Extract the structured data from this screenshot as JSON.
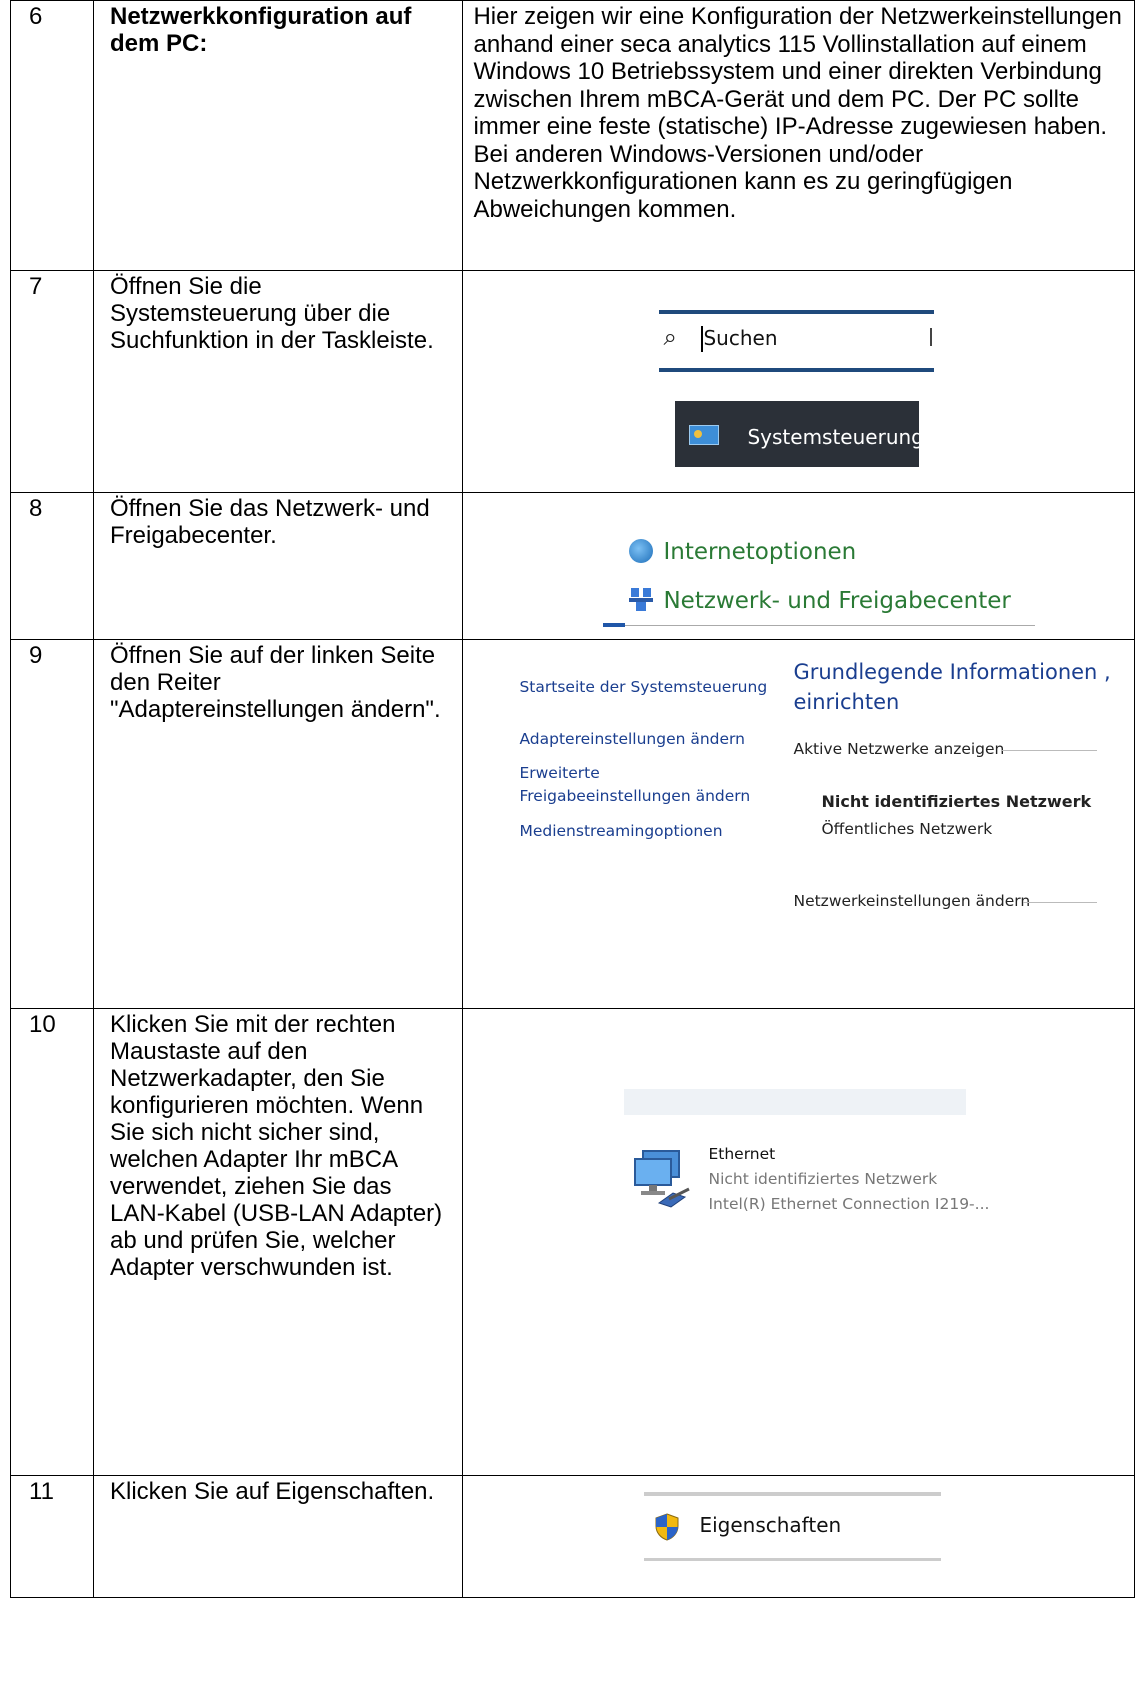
{
  "rows": [
    {
      "num": "6",
      "title": "Netzwerkkonfiguration auf dem PC:",
      "text": "Hier zeigen wir eine Konfiguration der Netzwerkeinstellungen anhand einer seca analytics 115 Vollinstallation auf einem Windows 10 Betriebssystem und einer direkten Verbindung zwischen Ihrem mBCA-Gerät und dem PC. Der PC sollte immer eine feste (statische) IP-Adresse zugewiesen haben. Bei anderen Windows-Versionen und/oder Netzwerkkonfigurationen kann es zu geringfügigen Abweichungen kommen."
    },
    {
      "num": "7",
      "text": "Öffnen Sie die Systemsteuerung über die Suchfunktion in der Taskleiste.",
      "search_icon": "magnifier-icon",
      "search_text": "Suchen",
      "result_label": "Systemsteuerung"
    },
    {
      "num": "8",
      "text": "Öffnen Sie das Netzwerk- und Freigabecenter.",
      "items": [
        {
          "label": "Internetoptionen",
          "icon": "internet-options-icon"
        },
        {
          "label": "Netzwerk- und Freigabecenter",
          "icon": "network-center-icon"
        }
      ]
    },
    {
      "num": "9",
      "text": "Öffnen Sie auf der linken Seite den Reiter \"Adaptereinstellungen ändern\".",
      "left_links": [
        "Startseite der Systemsteuerung",
        "Adaptereinstellungen ändern",
        "Erweiterte",
        "Freigabeeinstellungen ändern",
        "Medienstreamingoptionen"
      ],
      "heading_cut": "Grundlegende Informationen ,",
      "heading2": "einrichten",
      "active_label": "Aktive Netzwerke anzeigen",
      "network_name": "Nicht identifiziertes Netzwerk",
      "network_type": "Öffentliches Netzwerk",
      "change_label": "Netzwerkeinstellungen ändern"
    },
    {
      "num": "10",
      "text": "Klicken Sie mit der rechten Maustaste auf den Netzwerkadapter, den Sie konfigurieren möchten. Wenn Sie sich nicht sicher sind, welchen Adapter Ihr mBCA verwendet, ziehen Sie das LAN-Kabel (USB-LAN Adapter) ab und prüfen Sie, welcher Adapter verschwunden ist.",
      "adapter_name": "Ethernet",
      "adapter_status": "Nicht identifiziertes Netzwerk",
      "adapter_device": "Intel(R) Ethernet Connection I219-..."
    },
    {
      "num": "11",
      "text": "Klicken Sie auf Eigenschaften.",
      "menu_label": "Eigenschaften",
      "menu_icon": "uac-shield-icon"
    }
  ]
}
